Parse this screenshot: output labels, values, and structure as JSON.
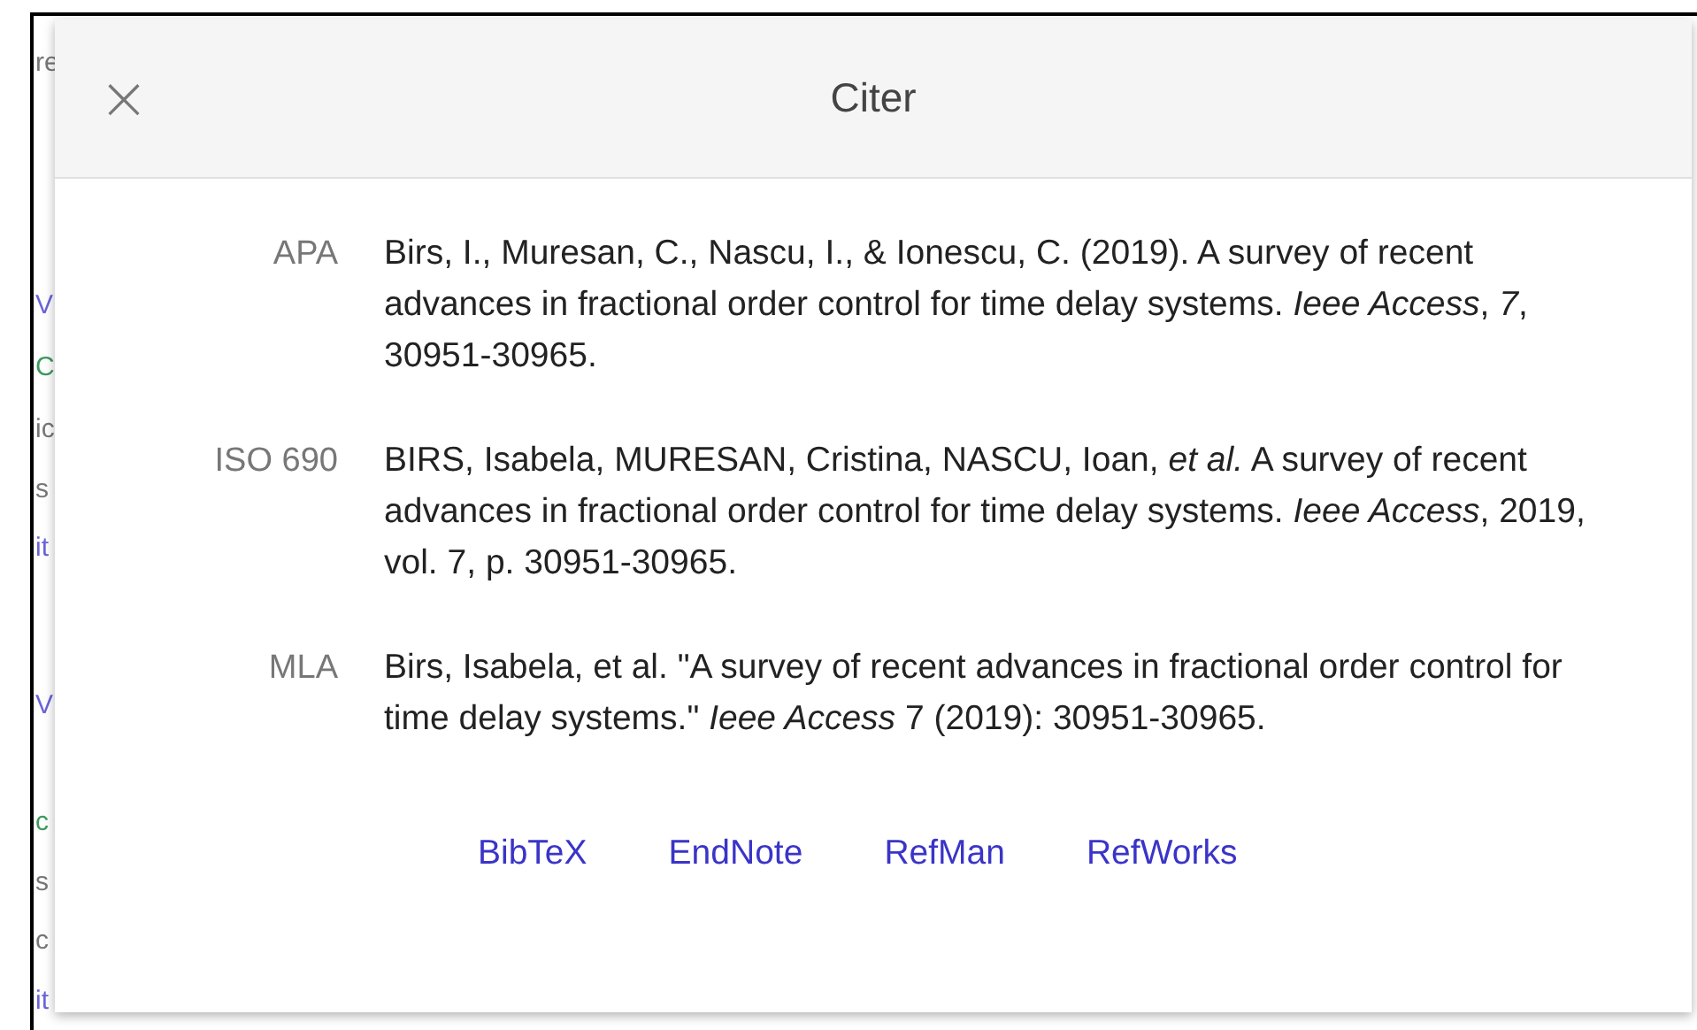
{
  "background_fragments": [
    {
      "text": "re",
      "kind": "plain"
    },
    {
      "text": "V",
      "kind": "link"
    },
    {
      "text": "C",
      "kind": "url"
    },
    {
      "text": "ic",
      "kind": "plain"
    },
    {
      "text": "s",
      "kind": "plain"
    },
    {
      "text": "it",
      "kind": "link"
    },
    {
      "text": "V",
      "kind": "link"
    },
    {
      "text": "c",
      "kind": "url"
    },
    {
      "text": "s",
      "kind": "plain"
    },
    {
      "text": "c",
      "kind": "plain"
    },
    {
      "text": "it",
      "kind": "link"
    }
  ],
  "dialog": {
    "title": "Citer",
    "close": "×",
    "citations": [
      {
        "style": "APA",
        "text": "Birs, I., Muresan, C., Nascu, I., & Ionescu, C. (2019). A survey of recent advances in fractional order control for time delay systems. *Ieee Access*, *7*, 30951-30965."
      },
      {
        "style": "ISO 690",
        "text": "BIRS, Isabela, MURESAN, Cristina, NASCU, Ioan, *et al.* A survey of recent advances in fractional order control for time delay systems. *Ieee Access*, 2019, vol. 7, p. 30951-30965."
      },
      {
        "style": "MLA",
        "text": "Birs, Isabela, et al. \"A survey of recent advances in fractional order control for time delay systems.\" *Ieee Access* 7 (2019): 30951-30965."
      }
    ],
    "export_links": [
      "BibTeX",
      "EndNote",
      "RefMan",
      "RefWorks"
    ]
  }
}
